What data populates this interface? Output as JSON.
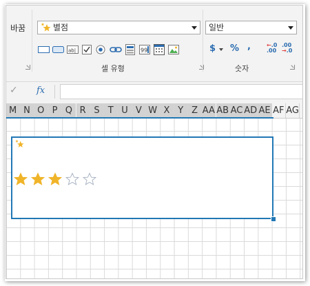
{
  "ribbon": {
    "left_group_label": "바꿈",
    "cell_style": {
      "combo_value": "별점",
      "combo_icon": "star-rating-icon",
      "group_label": "셀 유형",
      "controls": [
        {
          "name": "textbox-cell-icon"
        },
        {
          "name": "button-cell-icon"
        },
        {
          "name": "label-cell-icon",
          "text": "ab|"
        },
        {
          "name": "checkbox-cell-icon"
        },
        {
          "name": "radio-cell-icon"
        },
        {
          "name": "hyperlink-cell-icon"
        },
        {
          "name": "list-cell-icon"
        },
        {
          "name": "number-cell-icon",
          "text": "99"
        },
        {
          "name": "date-cell-icon"
        },
        {
          "name": "image-cell-icon"
        }
      ]
    },
    "number": {
      "combo_value": "일반",
      "group_label": "숫자",
      "currency_label": "$",
      "percent_label": "%",
      "comma_label": ",",
      "increase_decimal": [
        "←.0",
        ".00"
      ],
      "decrease_decimal": [
        ".00",
        "→.0"
      ]
    }
  },
  "formula_bar": {
    "fx_label": "fx",
    "value": ""
  },
  "sheet": {
    "columns": [
      "M",
      "N",
      "O",
      "P",
      "Q",
      "R",
      "S",
      "T",
      "U",
      "V",
      "W",
      "X",
      "Y",
      "Z",
      "AA",
      "AB",
      "AC",
      "AD",
      "AE",
      "AF",
      "AG"
    ],
    "selected_columns_through": "AE",
    "rating": {
      "value": 3,
      "max": 5
    },
    "accent_color": "#2177b5",
    "star_fill_color": "#f0b429"
  }
}
